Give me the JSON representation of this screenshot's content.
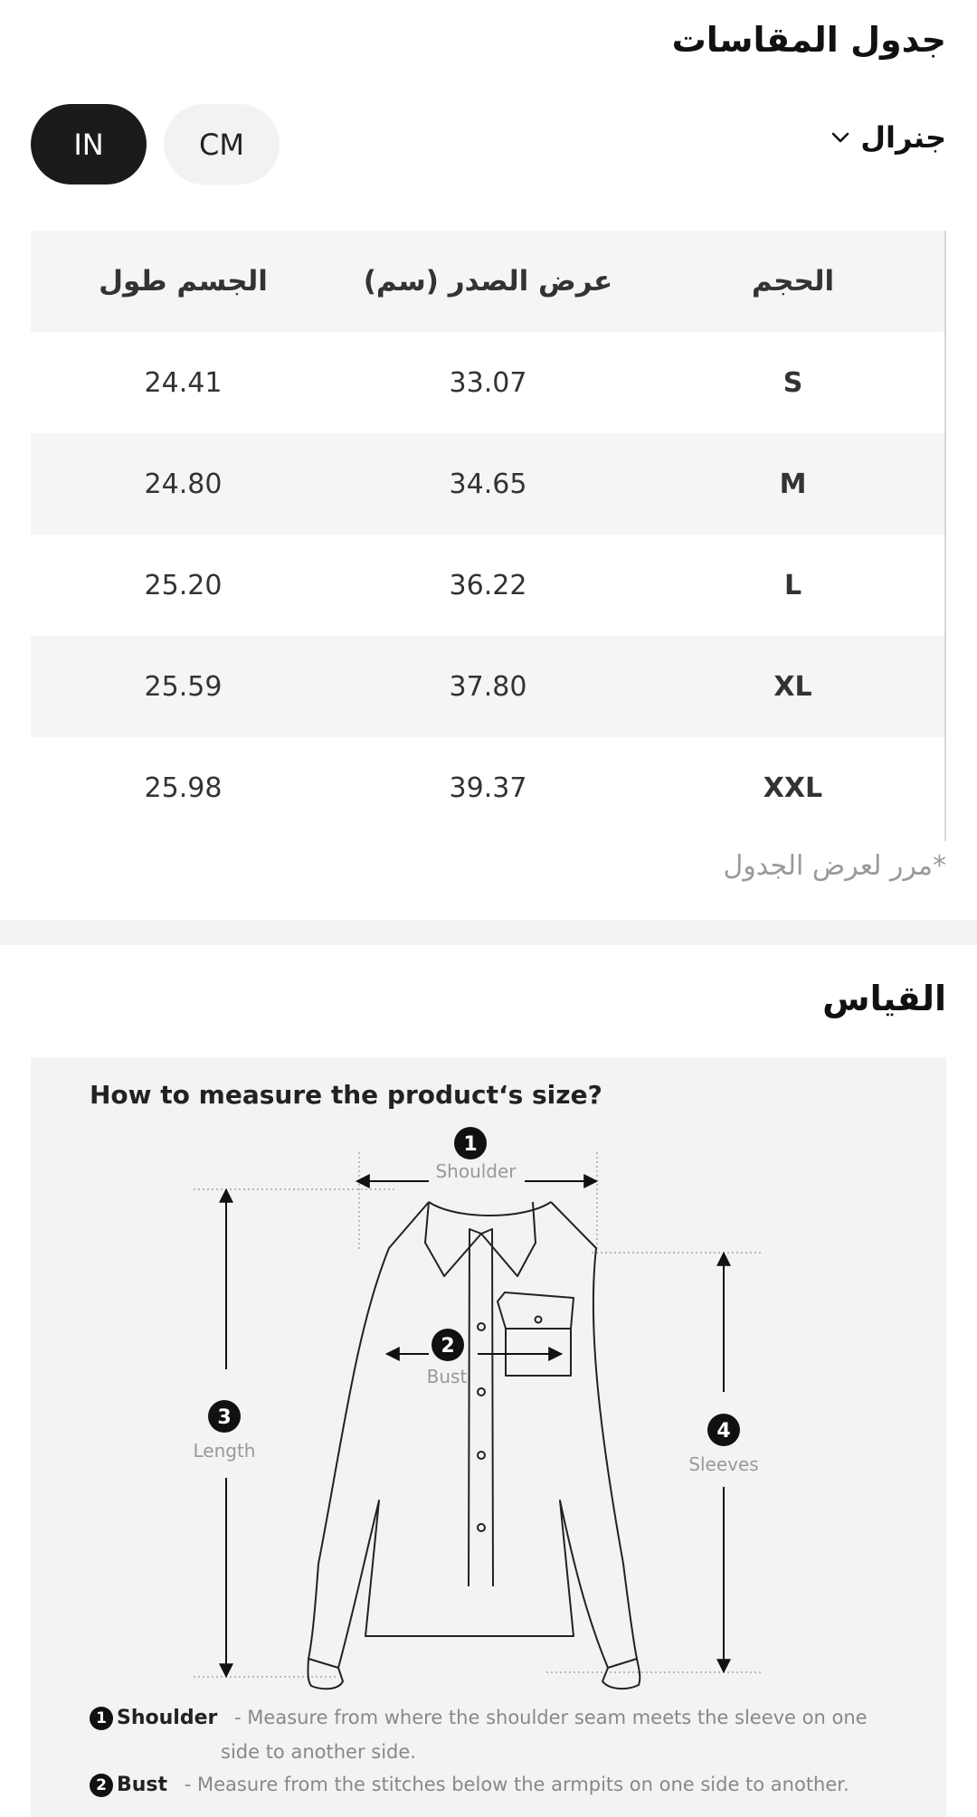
{
  "size_chart": {
    "title": "جدول المقاسات",
    "general_label": "جنرال",
    "units": {
      "in": "IN",
      "cm": "CM",
      "selected": "IN"
    },
    "columns": {
      "size": "الحجم",
      "bust": "عرض الصدر (سم)",
      "length": "الجسم طول"
    },
    "rows": [
      {
        "size": "S",
        "bust": "33.07",
        "length": "24.41"
      },
      {
        "size": "M",
        "bust": "34.65",
        "length": "24.80"
      },
      {
        "size": "L",
        "bust": "36.22",
        "length": "25.20"
      },
      {
        "size": "XL",
        "bust": "37.80",
        "length": "25.59"
      },
      {
        "size": "XXL",
        "bust": "39.37",
        "length": "25.98"
      }
    ],
    "scroll_hint": "*مرر لعرض الجدول"
  },
  "measure": {
    "title": "القياس",
    "guide_title": "How to measure the product‘s size?",
    "labels": {
      "n1": "1",
      "shoulder": "Shoulder",
      "n2": "2",
      "bust": "Bust",
      "n3": "3",
      "length": "Length",
      "n4": "4",
      "sleeves": "Sleeves"
    },
    "legend": [
      {
        "num": "1",
        "name": "Shoulder",
        "desc": "- Measure from where the shoulder seam meets the sleeve on one",
        "desc2": "side to another side."
      },
      {
        "num": "2",
        "name": "Bust",
        "desc": "- Measure from the stitches below the armpits on one side to another."
      }
    ]
  },
  "colors": {
    "selected_bg": "#1b1b1b",
    "unselected_bg": "#f2f2f2",
    "row_shade": "#f5f5f5",
    "panel_bg": "#f3f3f3"
  }
}
